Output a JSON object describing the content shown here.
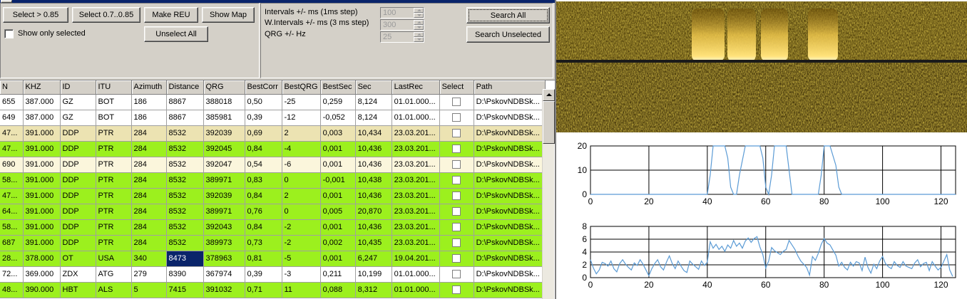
{
  "toolbar": {
    "select_085": "Select > 0.85",
    "select_07_085": "Select 0.7..0.85",
    "make_reu": "Make REU",
    "show_map": "Show Map",
    "unselect_all": "Unselect All",
    "show_only_selected": "Show only selected",
    "search_all": "Search All",
    "search_unselected": "Search Unselected"
  },
  "params": {
    "intervals_label": "Intervals +/- ms (1ms step)",
    "intervals_value": "100",
    "w_intervals_label": "W.Intervals +/- ms (3 ms step)",
    "w_intervals_value": "300",
    "qrg_label": "QRG +/- Hz",
    "qrg_value": "25"
  },
  "table": {
    "columns": [
      "N",
      "KHZ",
      "ID",
      "ITU",
      "Azimuth",
      "Distance",
      "QRG",
      "BestCorr",
      "BestQRG",
      "BestSec",
      "Sec",
      "LastRec",
      "Select",
      "Path"
    ],
    "rows": [
      {
        "cells": [
          "655",
          "387.000",
          "GZ",
          "BOT",
          "186",
          "8867",
          "388018",
          "0,50",
          "-25",
          "0,259",
          "8,124",
          "01.01.000...",
          "",
          "D:\\PskovNDBSk..."
        ],
        "bg": "#ffffff"
      },
      {
        "cells": [
          "649",
          "387.000",
          "GZ",
          "BOT",
          "186",
          "8867",
          "385981",
          "0,39",
          "-12",
          "-0,052",
          "8,124",
          "01.01.000...",
          "",
          "D:\\PskovNDBSk..."
        ],
        "bg": "#ffffff"
      },
      {
        "cells": [
          "47...",
          "391.000",
          "DDP",
          "PTR",
          "284",
          "8532",
          "392039",
          "0,69",
          "2",
          "0,003",
          "10,434",
          "23.03.201...",
          "",
          "D:\\PskovNDBSk..."
        ],
        "bg": "#ece3b2"
      },
      {
        "cells": [
          "47...",
          "391.000",
          "DDP",
          "PTR",
          "284",
          "8532",
          "392045",
          "0,84",
          "-4",
          "0,001",
          "10,436",
          "23.03.201...",
          "",
          "D:\\PskovNDBSk..."
        ],
        "bg": "#9cf01e"
      },
      {
        "cells": [
          "690",
          "391.000",
          "DDP",
          "PTR",
          "284",
          "8532",
          "392047",
          "0,54",
          "-6",
          "0,001",
          "10,436",
          "23.03.201...",
          "",
          "D:\\PskovNDBSk..."
        ],
        "bg": "#fbf6dc"
      },
      {
        "cells": [
          "58...",
          "391.000",
          "DDP",
          "PTR",
          "284",
          "8532",
          "389971",
          "0,83",
          "0",
          "-0,001",
          "10,438",
          "23.03.201...",
          "",
          "D:\\PskovNDBSk..."
        ],
        "bg": "#9cf01e"
      },
      {
        "cells": [
          "47...",
          "391.000",
          "DDP",
          "PTR",
          "284",
          "8532",
          "392039",
          "0,84",
          "2",
          "0,001",
          "10,436",
          "23.03.201...",
          "",
          "D:\\PskovNDBSk..."
        ],
        "bg": "#9cf01e"
      },
      {
        "cells": [
          "64...",
          "391.000",
          "DDP",
          "PTR",
          "284",
          "8532",
          "389971",
          "0,76",
          "0",
          "0,005",
          "20,870",
          "23.03.201...",
          "",
          "D:\\PskovNDBSk..."
        ],
        "bg": "#9cf01e"
      },
      {
        "cells": [
          "58...",
          "391.000",
          "DDP",
          "PTR",
          "284",
          "8532",
          "392043",
          "0,84",
          "-2",
          "0,001",
          "10,436",
          "23.03.201...",
          "",
          "D:\\PskovNDBSk..."
        ],
        "bg": "#9cf01e"
      },
      {
        "cells": [
          "687",
          "391.000",
          "DDP",
          "PTR",
          "284",
          "8532",
          "389973",
          "0,73",
          "-2",
          "0,002",
          "10,435",
          "23.03.201...",
          "",
          "D:\\PskovNDBSk..."
        ],
        "bg": "#9cf01e"
      },
      {
        "cells": [
          "28...",
          "378.000",
          "OT",
          "USA",
          "340",
          "8473",
          "378963",
          "0,81",
          "-5",
          "0,001",
          "6,247",
          "19.04.201...",
          "",
          "D:\\PskovNDBSk..."
        ],
        "bg": "#9cf01e",
        "highlight": 5
      },
      {
        "cells": [
          "72...",
          "369.000",
          "ZDX",
          "ATG",
          "279",
          "8390",
          "367974",
          "0,39",
          "-3",
          "0,211",
          "10,199",
          "01.01.000...",
          "",
          "D:\\PskovNDBSk..."
        ],
        "bg": "#ffffff"
      },
      {
        "cells": [
          "48...",
          "390.000",
          "HBT",
          "ALS",
          "5",
          "7415",
          "391032",
          "0,71",
          "11",
          "0,088",
          "8,312",
          "01.01.000...",
          "",
          "D:\\PskovNDBSk..."
        ],
        "bg": "#9cf01e"
      }
    ]
  },
  "chart_data": [
    {
      "type": "line",
      "xlim": [
        0,
        125
      ],
      "ylim": [
        0,
        20
      ],
      "xticks": [
        0,
        20,
        40,
        60,
        80,
        100,
        120
      ],
      "yticks": [
        0,
        10,
        20
      ],
      "grid": true,
      "x": [
        0,
        40,
        41,
        42,
        44,
        46,
        47,
        48,
        49,
        50,
        51,
        53,
        54,
        56,
        58,
        59,
        60,
        61,
        62,
        63,
        65,
        67,
        68,
        69,
        70,
        71,
        74,
        76,
        78,
        79,
        80,
        81,
        82,
        84,
        85,
        86,
        125
      ],
      "values": [
        0,
        0,
        8,
        20,
        20,
        20,
        15,
        3,
        0,
        0,
        8,
        20,
        20,
        20,
        20,
        15,
        3,
        0,
        8,
        20,
        20,
        20,
        10,
        0,
        0,
        0,
        0,
        0,
        0,
        8,
        20,
        20,
        20,
        12,
        3,
        0,
        0
      ],
      "series_color": "#5b9bd5"
    },
    {
      "type": "line",
      "xlim": [
        0,
        125
      ],
      "ylim": [
        0,
        8
      ],
      "xticks": [
        0,
        20,
        40,
        60,
        80,
        100,
        120
      ],
      "yticks": [
        0,
        2,
        4,
        6,
        8
      ],
      "grid": true,
      "x": [
        0,
        1,
        2,
        3,
        4,
        5,
        6,
        7,
        8,
        9,
        10,
        11,
        12,
        13,
        14,
        15,
        16,
        17,
        18,
        19,
        20,
        21,
        22,
        23,
        24,
        25,
        26,
        27,
        28,
        29,
        30,
        31,
        32,
        33,
        34,
        35,
        36,
        37,
        38,
        39,
        40,
        41,
        42,
        43,
        44,
        45,
        46,
        47,
        48,
        49,
        50,
        51,
        52,
        53,
        54,
        55,
        56,
        57,
        58,
        59,
        60,
        61,
        62,
        63,
        64,
        65,
        66,
        67,
        68,
        69,
        70,
        71,
        72,
        73,
        74,
        75,
        76,
        77,
        78,
        79,
        80,
        81,
        82,
        83,
        84,
        85,
        86,
        87,
        88,
        89,
        90,
        91,
        92,
        93,
        94,
        95,
        96,
        97,
        98,
        99,
        100,
        101,
        102,
        103,
        104,
        105,
        106,
        107,
        108,
        109,
        110,
        111,
        112,
        113,
        114,
        115,
        116,
        117,
        118,
        119,
        120,
        121,
        122,
        123,
        124
      ],
      "values": [
        2.8,
        1.5,
        0.6,
        1.2,
        2.4,
        2.2,
        1.8,
        2.6,
        1.4,
        0.9,
        2.2,
        2.8,
        2.1,
        1.6,
        1.2,
        2.3,
        1.9,
        2.8,
        2.1,
        1.2,
        0.3,
        1.4,
        2.2,
        2.8,
        1.7,
        1.2,
        2.4,
        3.4,
        2.2,
        1.4,
        2.6,
        1.8,
        1.1,
        0.8,
        2.6,
        2.1,
        1.7,
        1.3,
        2.6,
        1.9,
        2.4,
        5.6,
        4.6,
        5.2,
        4.4,
        4.9,
        4.1,
        5.1,
        4.6,
        5.8,
        4.9,
        5.4,
        4.6,
        5.7,
        6.2,
        5.5,
        6.1,
        6.4,
        4.8,
        3.6,
        1.5,
        2.6,
        4.7,
        4.2,
        3.9,
        3.6,
        4.1,
        4.4,
        5.8,
        5.1,
        4.4,
        3.4,
        2.6,
        2.1,
        1.6,
        0.4,
        3.3,
        2.7,
        3.8,
        5.2,
        6.1,
        5.4,
        5.1,
        4.3,
        3.5,
        1.8,
        2.4,
        1.6,
        1.2,
        2.4,
        1.8,
        2.5,
        2.3,
        1.1,
        3.2,
        1.6,
        0.7,
        2.1,
        1.4,
        2.6,
        3.3,
        2.2,
        1.7,
        1.4,
        2.5,
        1.9,
        1.6,
        2.5,
        1.8,
        1.6,
        1.4,
        2.3,
        2.8,
        1.7,
        2.2,
        2.4,
        1.1,
        2.5,
        1.8,
        1.2,
        1.6,
        2.6,
        3.6,
        1.2,
        0.2
      ],
      "series_color": "#5b9bd5"
    }
  ]
}
